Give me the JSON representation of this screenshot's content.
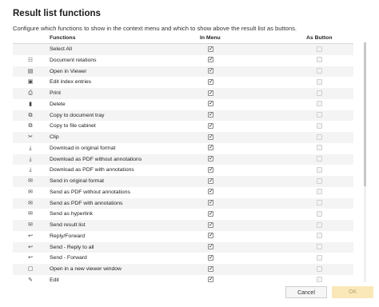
{
  "dialog": {
    "title": "Result list functions",
    "description": "Configure which functions to show in the context menu and which to show above the result list as buttons."
  },
  "table": {
    "headers": {
      "functions": "Functions",
      "in_menu": "In Menu",
      "as_button": "As Button"
    },
    "rows": [
      {
        "label": "Select All",
        "icon": "none",
        "in_menu": true,
        "as_button": false
      },
      {
        "label": "Document relations",
        "icon": "relations-icon",
        "in_menu": true,
        "as_button": false
      },
      {
        "label": "Open in Viewer",
        "icon": "document-icon",
        "in_menu": true,
        "as_button": false
      },
      {
        "label": "Edit index entries",
        "icon": "edit-index-icon",
        "in_menu": true,
        "as_button": false
      },
      {
        "label": "Print",
        "icon": "printer-icon",
        "in_menu": true,
        "as_button": false
      },
      {
        "label": "Delete",
        "icon": "trash-icon",
        "in_menu": true,
        "as_button": false
      },
      {
        "label": "Copy to document tray",
        "icon": "copy-icon",
        "in_menu": true,
        "as_button": false
      },
      {
        "label": "Copy to file cabinet",
        "icon": "copy-icon",
        "in_menu": true,
        "as_button": false
      },
      {
        "label": "Clip",
        "icon": "paperclip-icon",
        "in_menu": true,
        "as_button": false
      },
      {
        "label": "Download in original format",
        "icon": "download-icon",
        "in_menu": true,
        "as_button": false
      },
      {
        "label": "Download as PDF without annotations",
        "icon": "download-icon",
        "in_menu": true,
        "as_button": false
      },
      {
        "label": "Download as PDF with annotations",
        "icon": "download-icon",
        "in_menu": true,
        "as_button": false
      },
      {
        "label": "Send in original format",
        "icon": "envelope-icon",
        "in_menu": true,
        "as_button": false
      },
      {
        "label": "Send as PDF without annotations",
        "icon": "envelope-icon",
        "in_menu": true,
        "as_button": false
      },
      {
        "label": "Send as PDF with annotations",
        "icon": "envelope-icon",
        "in_menu": true,
        "as_button": false
      },
      {
        "label": "Send as hyperlink",
        "icon": "envelope-icon",
        "in_menu": true,
        "as_button": false
      },
      {
        "label": "Send result list",
        "icon": "envelope-icon",
        "in_menu": true,
        "as_button": false
      },
      {
        "label": "Reply/Forward",
        "icon": "reply-icon",
        "in_menu": true,
        "as_button": false
      },
      {
        "label": "Send - Reply to all",
        "icon": "reply-icon",
        "in_menu": true,
        "as_button": false
      },
      {
        "label": "Send - Forward",
        "icon": "reply-icon",
        "in_menu": true,
        "as_button": false
      },
      {
        "label": "Open in a new viewer window",
        "icon": "window-icon",
        "in_menu": true,
        "as_button": false
      },
      {
        "label": "Edit",
        "icon": "pencil-icon",
        "in_menu": true,
        "as_button": false
      }
    ]
  },
  "footer": {
    "cancel_label": "Cancel",
    "ok_label": "OK"
  },
  "colors": {
    "ok_bg": "#fbe8b8",
    "ok_text": "#b8a070",
    "row_alt": "#f4f4f4"
  }
}
